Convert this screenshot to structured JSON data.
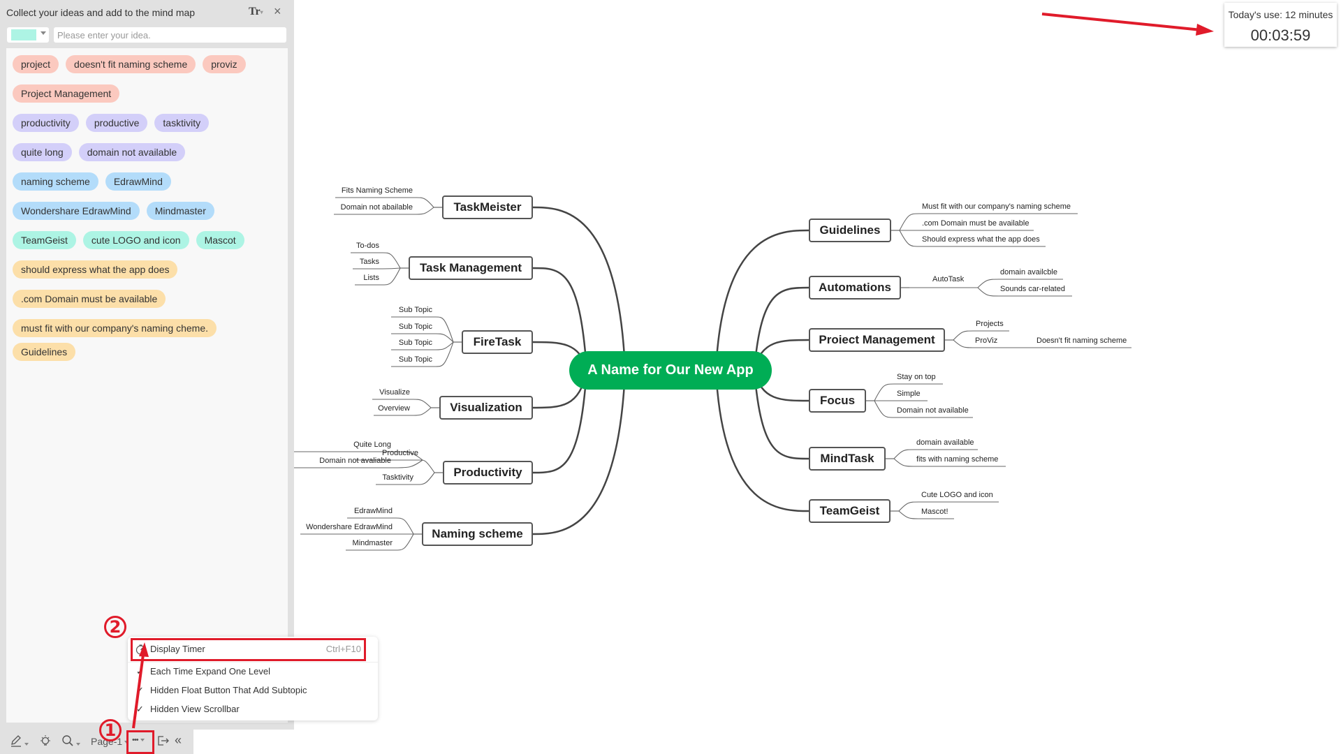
{
  "sidebar": {
    "title": "Collect your ideas and add to the mind map",
    "text_style_icon": "Tr",
    "close_icon": "×",
    "selected_color": "#adf4e4",
    "input_placeholder": "Please enter your idea.",
    "input_value": "",
    "tags": [
      {
        "label": "project",
        "color": "#fbc9bf"
      },
      {
        "label": "doesn't fit naming scheme",
        "color": "#fbc9bf"
      },
      {
        "label": "proviz",
        "color": "#fbc9bf"
      },
      {
        "label": "Project Management",
        "color": "#fbc9bf"
      },
      {
        "label": "productivity",
        "color": "#d3cff9"
      },
      {
        "label": "productive",
        "color": "#d3cff9"
      },
      {
        "label": "tasktivity",
        "color": "#d3cff9"
      },
      {
        "label": "quite long",
        "color": "#d3cff9"
      },
      {
        "label": "domain not available",
        "color": "#d3cff9"
      },
      {
        "label": "naming scheme",
        "color": "#b3dcfa"
      },
      {
        "label": "EdrawMind",
        "color": "#b3dcfa"
      },
      {
        "label": "Wondershare EdrawMind",
        "color": "#b3dcfa"
      },
      {
        "label": "Mindmaster",
        "color": "#b3dcfa"
      },
      {
        "label": "TeamGeist",
        "color": "#adf4e4"
      },
      {
        "label": "cute LOGO and icon",
        "color": "#adf4e4"
      },
      {
        "label": "Mascot",
        "color": "#adf4e4"
      },
      {
        "label": "should express what the app does",
        "color": "#fcdfa9"
      },
      {
        "label": ".com Domain must be available",
        "color": "#fcdfa9"
      },
      {
        "label": "must fit with our company's naming cheme.",
        "color": "#fcdfa9"
      },
      {
        "label": "Guidelines",
        "color": "#fcdfa9"
      }
    ]
  },
  "toolbar": {
    "page_label": "Page-1",
    "more_label": "•••"
  },
  "menu": {
    "items": [
      {
        "label": "Display Timer",
        "shortcut": "Ctrl+F10",
        "icon": "timer-icon",
        "checked": false
      },
      {
        "label": "Each Time Expand One Level",
        "shortcut": "",
        "checked": true
      },
      {
        "label": "Hidden Float Button That Add Subtopic",
        "shortcut": "",
        "checked": true
      },
      {
        "label": "Hidden View Scrollbar",
        "shortcut": "",
        "checked": true
      }
    ]
  },
  "annotations": {
    "step1": "1",
    "step2": "2",
    "accent": "#e01b2a"
  },
  "timer": {
    "label": "Today's use:  12 minutes",
    "value": "00:03:59"
  },
  "mindmap": {
    "central": {
      "label": "A Name for Our New App",
      "color": "#00ad55"
    },
    "left": [
      {
        "label": "TaskMeister",
        "children": [
          {
            "label": "Fits Naming Scheme"
          },
          {
            "label": "Domain not abailable"
          }
        ]
      },
      {
        "label": "Task Management",
        "children": [
          {
            "label": "To-dos"
          },
          {
            "label": "Tasks"
          },
          {
            "label": "Lists"
          }
        ]
      },
      {
        "label": "FireTask",
        "children": [
          {
            "label": "Sub Topic"
          },
          {
            "label": "Sub Topic"
          },
          {
            "label": "Sub Topic"
          },
          {
            "label": "Sub Topic"
          }
        ]
      },
      {
        "label": "Visualization",
        "children": [
          {
            "label": "Visualize"
          },
          {
            "label": "Overview"
          }
        ]
      },
      {
        "label": "Productivity",
        "children": [
          {
            "label": "Productive",
            "children": [
              {
                "label": "Quite Long"
              },
              {
                "label": "Domain not avaliable"
              }
            ]
          },
          {
            "label": "Tasktivity"
          }
        ]
      },
      {
        "label": "Naming scheme",
        "children": [
          {
            "label": "EdrawMind"
          },
          {
            "label": "Wondershare EdrawMind"
          },
          {
            "label": "Mindmaster"
          }
        ]
      }
    ],
    "right": [
      {
        "label": "Guidelines",
        "children": [
          {
            "label": "Must fit with our company's naming scheme"
          },
          {
            "label": ".com Domain must be available"
          },
          {
            "label": "Should express what the app does"
          }
        ]
      },
      {
        "label": "Automations",
        "children": [
          {
            "label": "AutoTask",
            "children": [
              {
                "label": "domain availcble"
              },
              {
                "label": "Sounds car-related"
              }
            ]
          }
        ]
      },
      {
        "label": "Proiect Management",
        "children": [
          {
            "label": "Projects"
          },
          {
            "label": "ProViz",
            "children": [
              {
                "label": "Doesn't fit naming scheme"
              }
            ]
          }
        ]
      },
      {
        "label": "Focus",
        "children": [
          {
            "label": "Stay on top"
          },
          {
            "label": "Simple"
          },
          {
            "label": "Domain not available"
          }
        ]
      },
      {
        "label": "MindTask",
        "children": [
          {
            "label": "domain available"
          },
          {
            "label": "fits with naming scheme"
          }
        ]
      },
      {
        "label": "TeamGeist",
        "children": [
          {
            "label": "Cute LOGO and icon"
          },
          {
            "label": "Mascot!"
          }
        ]
      }
    ]
  }
}
